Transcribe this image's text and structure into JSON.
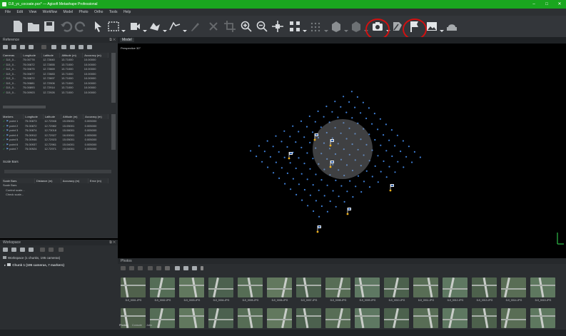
{
  "window": {
    "title": "DJI_yc_cocoate.psx* — Agisoft Metashape Professional",
    "controls": [
      "–",
      "□",
      "✕"
    ]
  },
  "menu": [
    "File",
    "Edit",
    "View",
    "Workflow",
    "Model",
    "Photo",
    "Ortho",
    "Tools",
    "Help"
  ],
  "toolbar": {
    "icons": [
      "new-file-icon",
      "open-folder-icon",
      "save-icon",
      "undo-icon",
      "redo-icon",
      "pointer-icon",
      "rect-select-icon",
      "navigate-icon",
      "shape-icon",
      "ruler-icon",
      "brush-icon",
      "delete-icon",
      "crop-icon",
      "zoom-in-icon",
      "zoom-out-icon",
      "move-icon",
      "grid-points-icon",
      "dense-cloud-icon",
      "mesh-icon",
      "texture-icon",
      "camera-icon",
      "marker-icon",
      "flag-icon",
      "ortho-icon",
      "tiles-icon"
    ],
    "highlight_color": "#d21010"
  },
  "reference": {
    "title": "Reference",
    "cameras_headers": [
      "Cameras",
      "Longitude",
      "Latitude",
      "Altitude (m)",
      "Accuracy (m)"
    ],
    "cameras": [
      [
        "DJI_0...",
        "75.00778",
        "12.72840",
        "13.71000",
        "10.00000"
      ],
      [
        "DJI_0...",
        "75.00872",
        "12.72855",
        "13.71000",
        "10.00000"
      ],
      [
        "DJI_0...",
        "75.00875",
        "12.72869",
        "13.71000",
        "10.00000"
      ],
      [
        "DJI_0...",
        "75.00877",
        "12.72883",
        "13.71000",
        "10.00000"
      ],
      [
        "DJI_0...",
        "75.00872",
        "12.72897",
        "13.71000",
        "10.00000"
      ],
      [
        "DJI_0...",
        "75.00881",
        "12.72906",
        "13.71000",
        "10.00000"
      ],
      [
        "DJI_0...",
        "75.00893",
        "12.72914",
        "13.71000",
        "10.00000"
      ],
      [
        "DJI_0...",
        "75.00903",
        "12.72926",
        "13.71000",
        "10.00000"
      ]
    ],
    "markers_headers": [
      "Markers",
      "Longitude",
      "Latitude",
      "Altitude (m)",
      "Accuracy (m)"
    ],
    "markers": [
      [
        "point 1",
        "75.00873",
        "12.72946",
        "15.05001",
        "0.005000"
      ],
      [
        "point 2",
        "75.00872",
        "12.72982",
        "15.05001",
        "0.005000"
      ],
      [
        "point 3",
        "75.00874",
        "12.73018",
        "15.06001",
        "0.005000"
      ],
      [
        "point 4",
        "75.00912",
        "12.72927",
        "16.00001",
        "0.005000"
      ],
      [
        "point 5",
        "75.00946",
        "12.72923",
        "15.05001",
        "0.005000"
      ],
      [
        "point 6",
        "75.00937",
        "12.72961",
        "15.04001",
        "0.005000"
      ],
      [
        "point 7",
        "75.00924",
        "12.72971",
        "15.04001",
        "0.005000"
      ]
    ],
    "scalebars_label": "Scale Bars",
    "scalebars_headers": [
      "Scale Bars",
      "Distance (m)",
      "Accuracy (m)",
      "Error (m)"
    ],
    "scalebars_groups": [
      "Scale Bars",
      "Control scale...",
      "Check scale..."
    ]
  },
  "workspace": {
    "title": "Workspace",
    "root": "Workspace (1 chunks, 195 cameras)",
    "chunk": "Chunk 1 (195 cameras, 7 markers)"
  },
  "viewport": {
    "tab": "Model",
    "perspective": "Perspective 30°"
  },
  "photos": {
    "title": "Photos",
    "bottom_tabs": [
      "Photos",
      "Console",
      "Jobs"
    ],
    "row1_labels": [
      "DJI_0001.JPG",
      "DJI_0002.JPG",
      "DJI_0003.JPG",
      "DJI_0004.JPG",
      "DJI_0005.JPG",
      "DJI_0006.JPG",
      "DJI_0007.JPG",
      "DJI_0008.JPG",
      "DJI_0009.JPG",
      "DJI_0010.JPG",
      "DJI_0011.JPG",
      "DJI_0012.JPG",
      "DJI_0013.JPG",
      "DJI_0014.JPG",
      "DJI_0015.JPG"
    ]
  },
  "colors": {
    "accent": "#1aa61f",
    "camera_dot": "#3f7fd6",
    "background": "#000000"
  }
}
